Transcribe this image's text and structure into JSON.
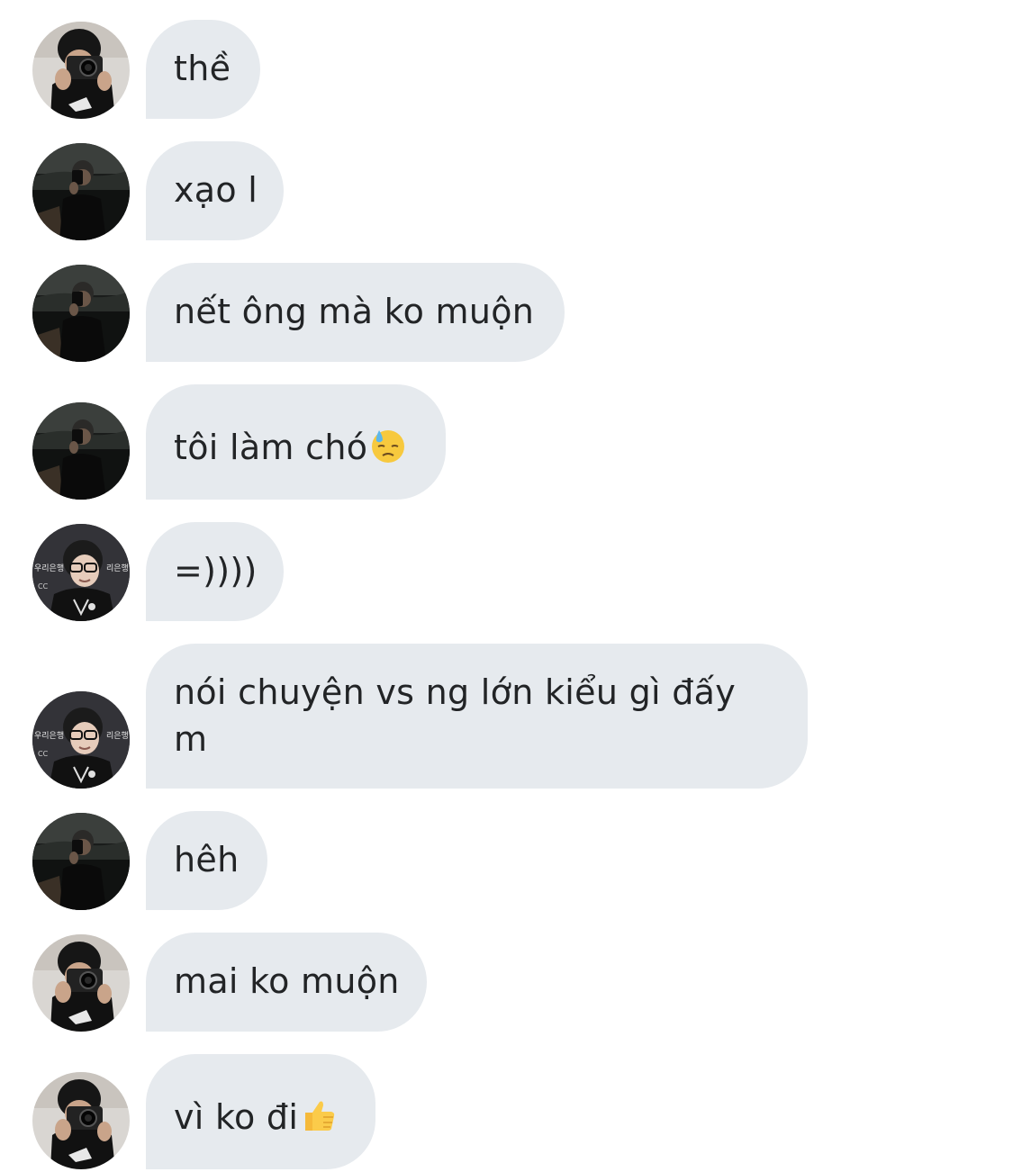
{
  "conversation": {
    "messages": [
      {
        "text": "thề",
        "avatar": "camera-avatar",
        "emoji": null
      },
      {
        "text": "xạo l",
        "avatar": "night-avatar",
        "emoji": null
      },
      {
        "text": "nết ông mà ko muộn",
        "avatar": "night-avatar",
        "emoji": null
      },
      {
        "text": "tôi làm chó",
        "avatar": "night-avatar",
        "emoji": "downcast-sweat-emoji"
      },
      {
        "text": "=))))",
        "avatar": "glasses-avatar",
        "emoji": null
      },
      {
        "text": "nói chuyện vs ng lớn kiểu gì đấy m",
        "avatar": "glasses-avatar",
        "emoji": null
      },
      {
        "text": "hêh",
        "avatar": "night-avatar",
        "emoji": null
      },
      {
        "text": "mai ko muộn",
        "avatar": "camera-avatar",
        "emoji": null
      },
      {
        "text": "vì ko đi",
        "avatar": "camera-avatar",
        "emoji": "thumbs-up-emoji"
      }
    ]
  },
  "colors": {
    "bubble": "#e6eaee",
    "text": "#222426",
    "background": "#ffffff"
  }
}
